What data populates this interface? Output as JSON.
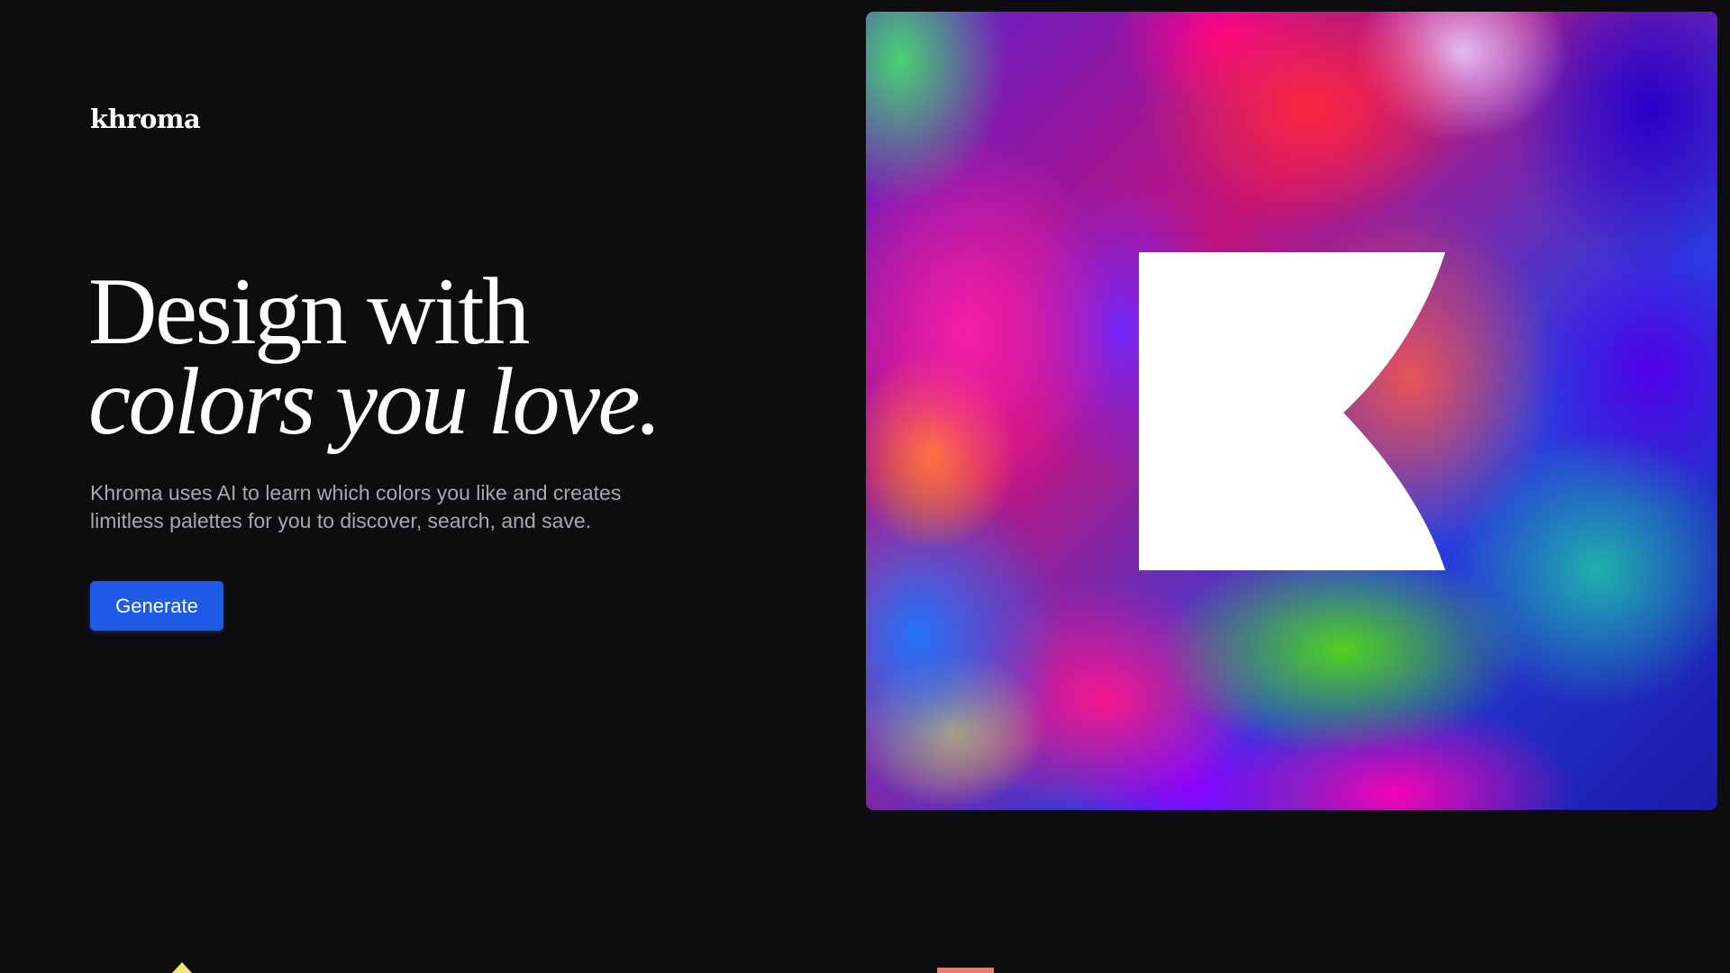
{
  "header": {
    "logo_text": "khroma"
  },
  "hero": {
    "headline_line1": "Design with",
    "headline_line2": "colors you love.",
    "description": "Khroma uses AI to learn which colors you like and creates limitless palettes for you to discover, search, and save.",
    "cta_label": "Generate",
    "image_icon": "khroma-k-logo-icon"
  },
  "colors": {
    "background": "#0d0d0f",
    "accent": "#1f5ae6",
    "text_primary": "#ffffff",
    "text_secondary": "#a8a8ad",
    "bottom_triangle": "#f3e27a",
    "bottom_swatch": "#e27b71"
  }
}
